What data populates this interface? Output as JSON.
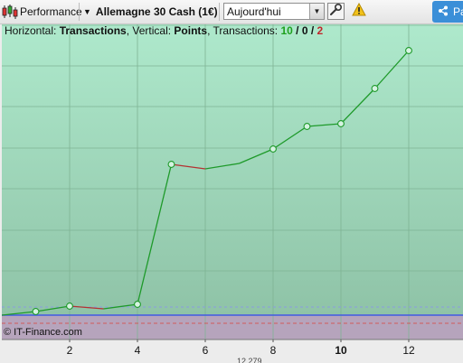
{
  "toolbar": {
    "performance_label": "Performance",
    "instrument_label": "Allemagne 30 Cash (1€)",
    "period_value": "Aujourd'hui",
    "share_label": "Pa"
  },
  "info": {
    "horizontal_prefix": "Horizontal: ",
    "horizontal_value": "Transactions",
    "vertical_prefix": ", Vertical: ",
    "vertical_value": "Points",
    "transactions_prefix": ", Transactions: ",
    "wins": "10",
    "slash1": " / ",
    "neutral": "0",
    "slash2": " / ",
    "losses": "2"
  },
  "copyright": "© IT-Finance.com",
  "bottom_cut_text": "12 279",
  "colors": {
    "win": "#1ea01e",
    "loss": "#c0282c",
    "line_up": "#1e9a2a",
    "line_down": "#b43232",
    "zero_line": "#3c5fe0"
  },
  "chart_data": {
    "type": "line",
    "x_tick_labels": [
      "2",
      "4",
      "6",
      "8",
      "10",
      "12"
    ],
    "x_tick_values": [
      2,
      4,
      6,
      8,
      10,
      12
    ],
    "highlighted_tick": "10",
    "x": [
      0,
      1,
      2,
      3,
      4,
      5,
      6,
      7,
      8,
      9,
      10,
      11,
      12
    ],
    "y": [
      0,
      4,
      10,
      7,
      12,
      167,
      162,
      168,
      184,
      209,
      212,
      251,
      293
    ],
    "xlim": [
      0,
      13
    ],
    "ylim": [
      -30,
      320
    ],
    "grid": true
  }
}
